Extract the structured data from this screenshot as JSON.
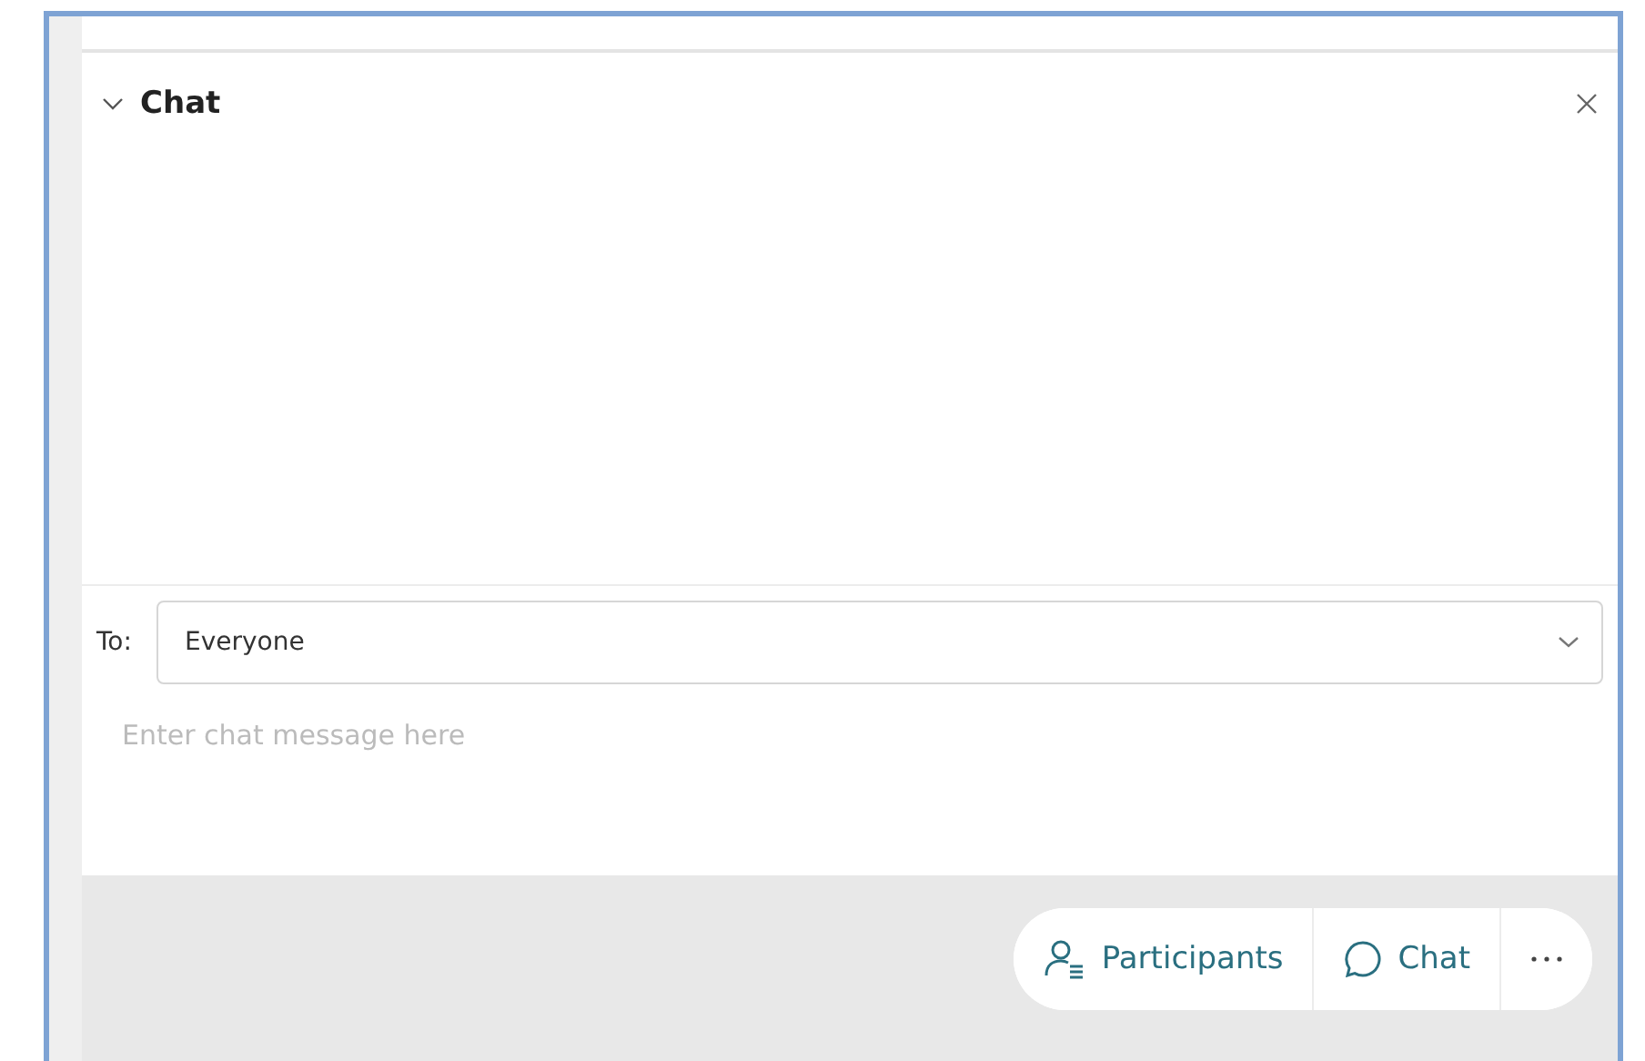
{
  "panel": {
    "title": "Chat",
    "expanded": true
  },
  "recipient": {
    "label": "To:",
    "value": "Everyone"
  },
  "message": {
    "placeholder": "Enter chat message here"
  },
  "toolbar": [
    {
      "kind": "participants",
      "label": "Participants"
    },
    {
      "kind": "chat",
      "label": "Chat"
    },
    {
      "kind": "more"
    }
  ]
}
